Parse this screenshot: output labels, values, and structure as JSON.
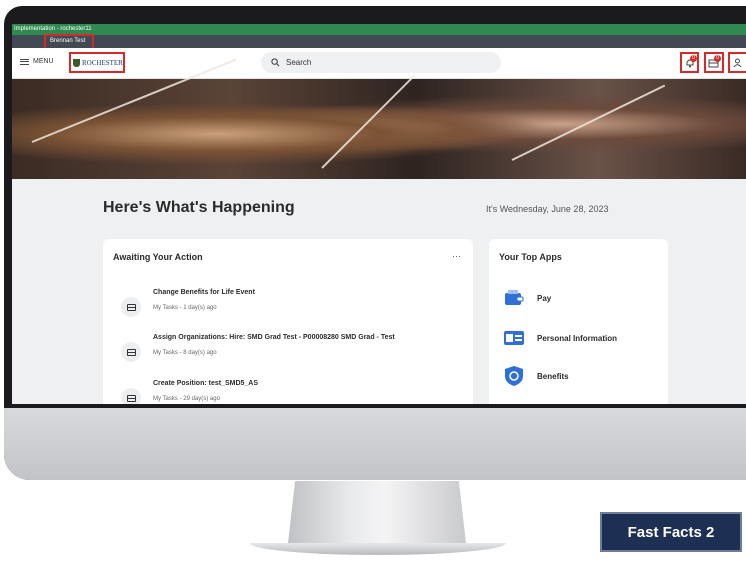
{
  "env": {
    "label": "Implementation - rochester11"
  },
  "user": {
    "name": "Brennan Test"
  },
  "topbar": {
    "menu_label": "MENU",
    "logo_text": "ROCHESTER",
    "search_placeholder": "Search",
    "notifications_badge": "0",
    "inbox_badge": "0"
  },
  "main": {
    "heading": "Here's What's Happening",
    "date": "It's Wednesday, June 28, 2023"
  },
  "awaiting": {
    "title": "Awaiting Your Action",
    "more_label": "···",
    "tasks": [
      {
        "title": "Change Benefits for Life Event",
        "sub": "My Tasks - 1 day(s) ago"
      },
      {
        "title": "Assign Organizations: Hire: SMD Grad Test - P00008280 SMD Grad - Test",
        "sub": "My Tasks - 8 day(s) ago"
      },
      {
        "title": "Create Position: test_SMD5_AS",
        "sub": "My Tasks - 29 day(s) ago"
      }
    ]
  },
  "apps": {
    "title": "Your Top Apps",
    "items": [
      {
        "label": "Pay",
        "icon": "wallet-icon"
      },
      {
        "label": "Personal Information",
        "icon": "id-card-icon"
      },
      {
        "label": "Benefits",
        "icon": "benefits-shield-icon"
      }
    ]
  },
  "footer": {
    "fast_facts": "Fast Facts 2"
  },
  "colors": {
    "env_bar": "#2f8a4f",
    "user_bar": "#414a52",
    "highlight": "#d42a2a",
    "fast_facts_bg": "#1d2f52",
    "app_blue": "#2f6fd6"
  }
}
